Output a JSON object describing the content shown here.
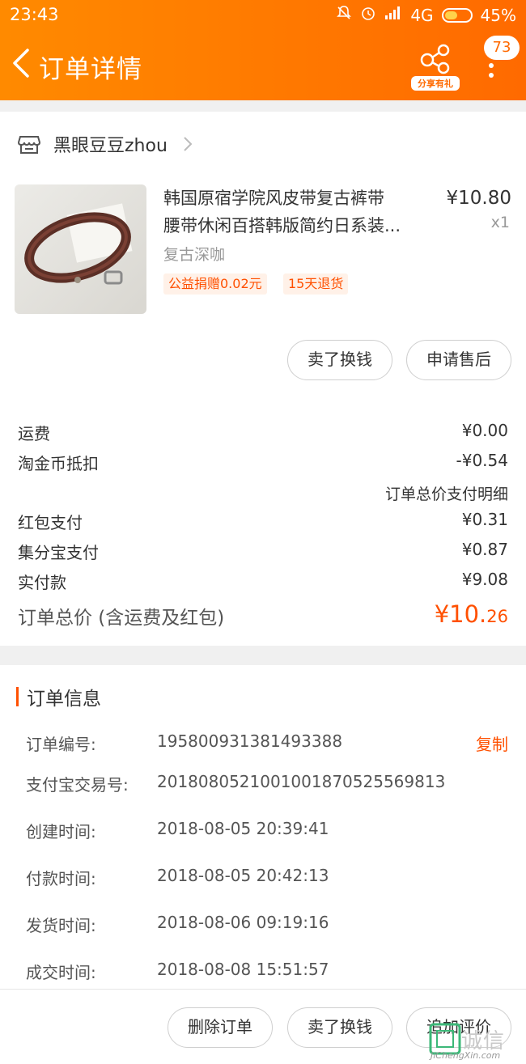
{
  "status_bar": {
    "time": "23:43",
    "network": "4G",
    "battery": "45%"
  },
  "header": {
    "title": "订单详情",
    "share_label": "分享有礼",
    "message_count": "73"
  },
  "shop": {
    "name": "黑眼豆豆zhou"
  },
  "product": {
    "title_line1": "韩国原宿学院风皮带复古裤带",
    "title_line2": "腰带休闲百搭韩版简约日系装...",
    "price": "¥10.80",
    "quantity": "x1",
    "sku": "复古深咖",
    "tags": [
      "公益捐赠0.02元",
      "15天退货"
    ]
  },
  "item_actions": {
    "sell_label": "卖了换钱",
    "service_label": "申请售后"
  },
  "fees": {
    "shipping_label": "运费",
    "shipping_value": "¥0.00",
    "coin_label": "淘金币抵扣",
    "coin_value": "-¥0.54",
    "detail_link": "订单总价支付明细",
    "redpacket_label": "红包支付",
    "redpacket_value": "¥0.31",
    "jifenbao_label": "集分宝支付",
    "jifenbao_value": "¥0.87",
    "paid_label": "实付款",
    "paid_value": "¥9.08",
    "total_label": "订单总价 (含运费及红包)",
    "total_value_main": "¥10.",
    "total_value_decimal": "26"
  },
  "order_info": {
    "section_title": "订单信息",
    "copy_label": "复制",
    "rows": [
      {
        "label": "订单编号:",
        "value": "195800931381493388"
      },
      {
        "label": "支付宝交易号:",
        "value": "2018080521001001870525569813"
      },
      {
        "label": "创建时间:",
        "value": "2018-08-05 20:39:41"
      },
      {
        "label": "付款时间:",
        "value": "2018-08-05 20:42:13"
      },
      {
        "label": "发货时间:",
        "value": "2018-08-06 09:19:16"
      },
      {
        "label": "成交时间:",
        "value": "2018-08-08 15:51:57"
      }
    ]
  },
  "bottom_actions": {
    "delete_label": "删除订单",
    "sell_label": "卖了换钱",
    "review_label": "追加评价"
  },
  "watermark": {
    "text": "诚信",
    "sub": "JiChengXin.com"
  },
  "colors": {
    "brand_orange": "#ff6a00",
    "price_orange": "#ff5000"
  }
}
